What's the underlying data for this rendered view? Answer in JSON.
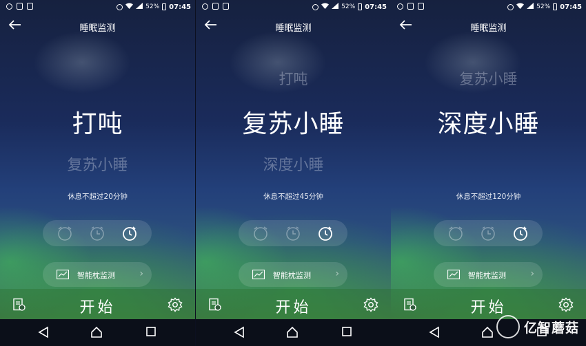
{
  "status": {
    "battery": "52%",
    "time": "07:45"
  },
  "title": "睡眠监测",
  "pillow_label": "智能枕监测",
  "start_label": "开始",
  "panels": [
    {
      "top_mode": "",
      "main_mode": "打吨",
      "lower_mode": "复苏小睡",
      "description": "休息不超过20分钟"
    },
    {
      "top_mode": "打吨",
      "main_mode": "复苏小睡",
      "lower_mode": "深度小睡",
      "description": "休息不超过45分钟"
    },
    {
      "top_mode": "复苏小睡",
      "main_mode": "深度小睡",
      "lower_mode": "",
      "description": "休息不超过120分钟"
    }
  ],
  "watermark": {
    "text": "亿智蘑菇"
  },
  "colors": {
    "accent_green": "#4d8a3a",
    "background_blue": "#1a2b5b"
  }
}
